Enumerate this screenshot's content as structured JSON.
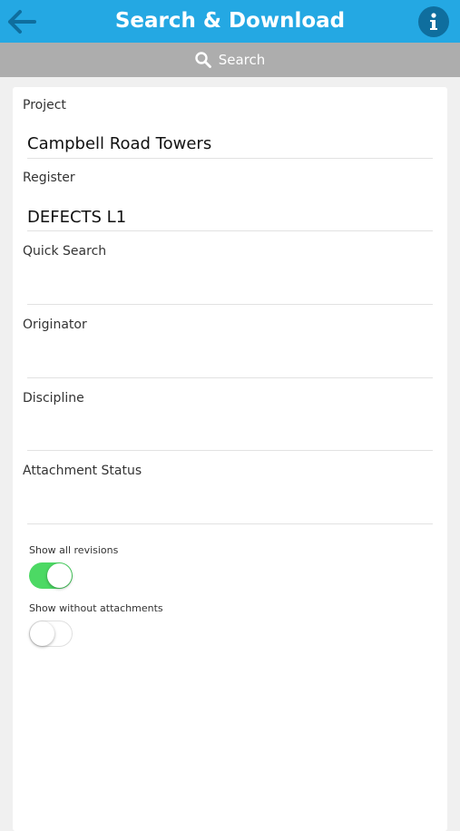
{
  "header": {
    "title": "Search & Download",
    "back_icon": "arrow-left-icon",
    "info_icon": "info-icon",
    "color": "#24a8e3"
  },
  "search_bar": {
    "label": "Search",
    "icon": "search-icon"
  },
  "form": {
    "project": {
      "label": "Project",
      "value": "Campbell Road Towers"
    },
    "register": {
      "label": "Register",
      "value": "DEFECTS L1"
    },
    "quick_search": {
      "label": "Quick Search",
      "value": ""
    },
    "originator": {
      "label": "Originator",
      "value": ""
    },
    "discipline": {
      "label": "Discipline",
      "value": ""
    },
    "attachment_status": {
      "label": "Attachment Status",
      "value": ""
    }
  },
  "toggles": {
    "show_all_revisions": {
      "label": "Show all revisions",
      "on": true,
      "color": "#4cd964"
    },
    "show_without_attachments": {
      "label": "Show without attachments",
      "on": false
    }
  }
}
